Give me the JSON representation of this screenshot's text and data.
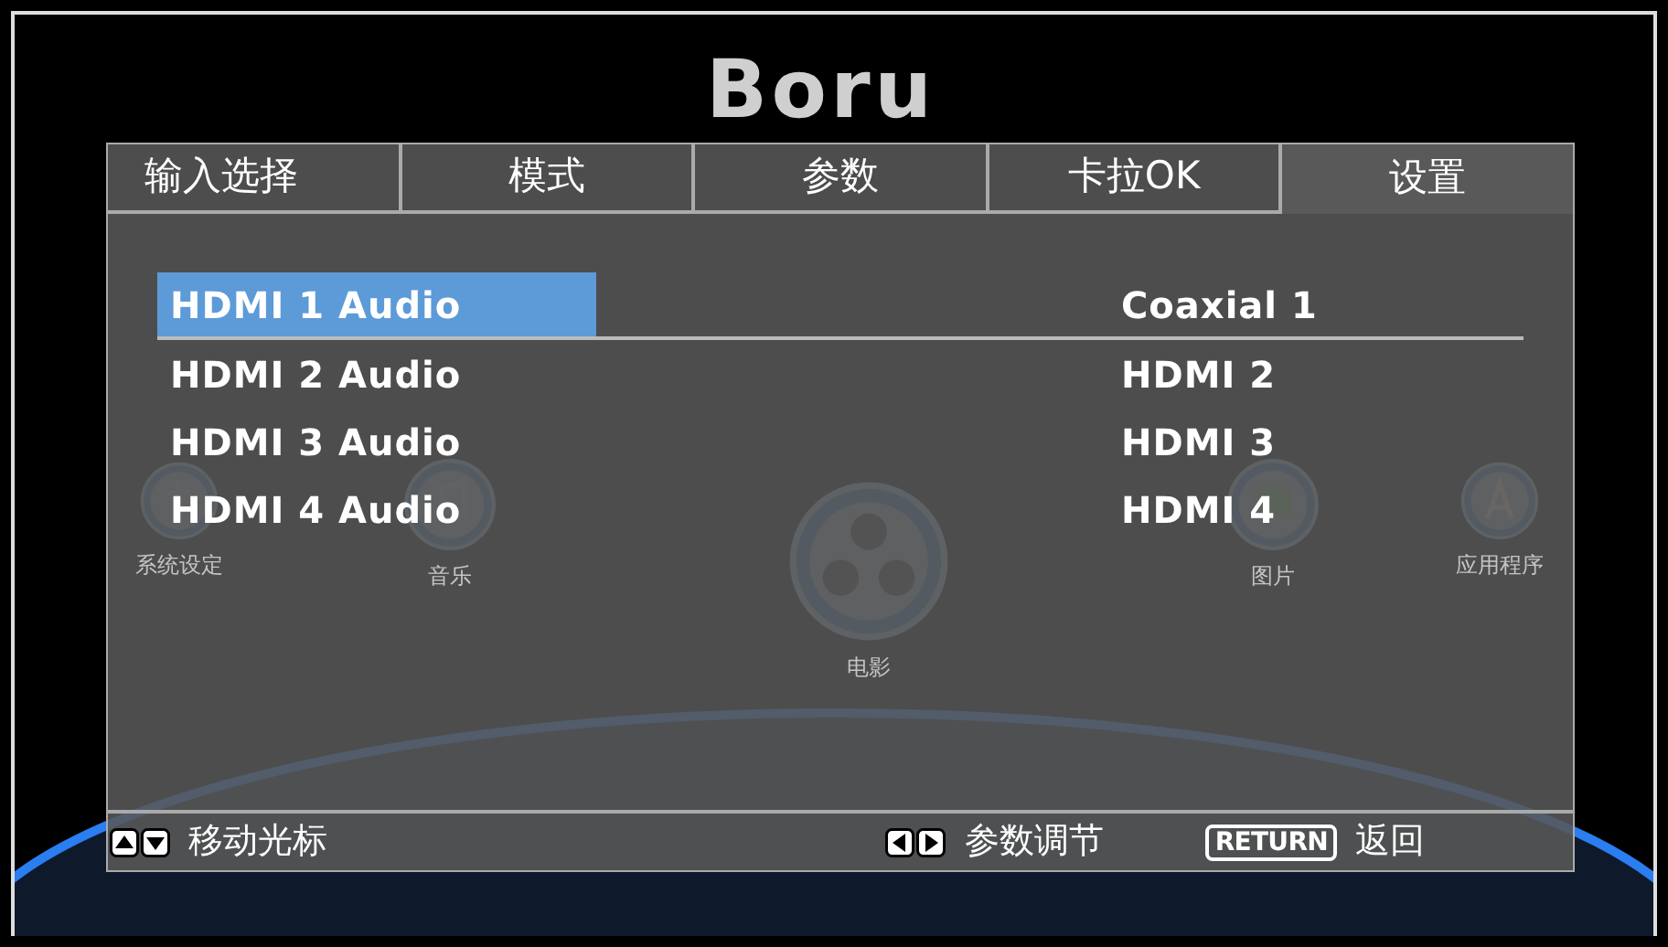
{
  "background": {
    "logo": "Boru",
    "apps": [
      {
        "kind": "settings",
        "label": "系统设定"
      },
      {
        "kind": "music",
        "label": "音乐"
      },
      {
        "kind": "film",
        "label": "电影"
      },
      {
        "kind": "picture",
        "label": "图片"
      },
      {
        "kind": "apps",
        "label": "应用程序"
      }
    ]
  },
  "tabs": [
    {
      "label": "输入选择",
      "selected": false
    },
    {
      "label": "模式",
      "selected": false
    },
    {
      "label": "参数",
      "selected": false
    },
    {
      "label": "卡拉OK",
      "selected": false
    },
    {
      "label": "设置",
      "selected": true
    }
  ],
  "rows": [
    {
      "label": "HDMI 1 Audio",
      "value": "Coaxial 1",
      "selected": true
    },
    {
      "label": "HDMI 2 Audio",
      "value": "HDMI 2",
      "selected": false
    },
    {
      "label": "HDMI 3 Audio",
      "value": "HDMI 3",
      "selected": false
    },
    {
      "label": "HDMI 4 Audio",
      "value": "HDMI 4",
      "selected": false
    }
  ],
  "footer": [
    {
      "kind": "updown",
      "label": "移动光标"
    },
    {
      "kind": "leftright",
      "label": "参数调节"
    },
    {
      "kind": "return",
      "key": "RETURN",
      "label": "返回"
    }
  ]
}
